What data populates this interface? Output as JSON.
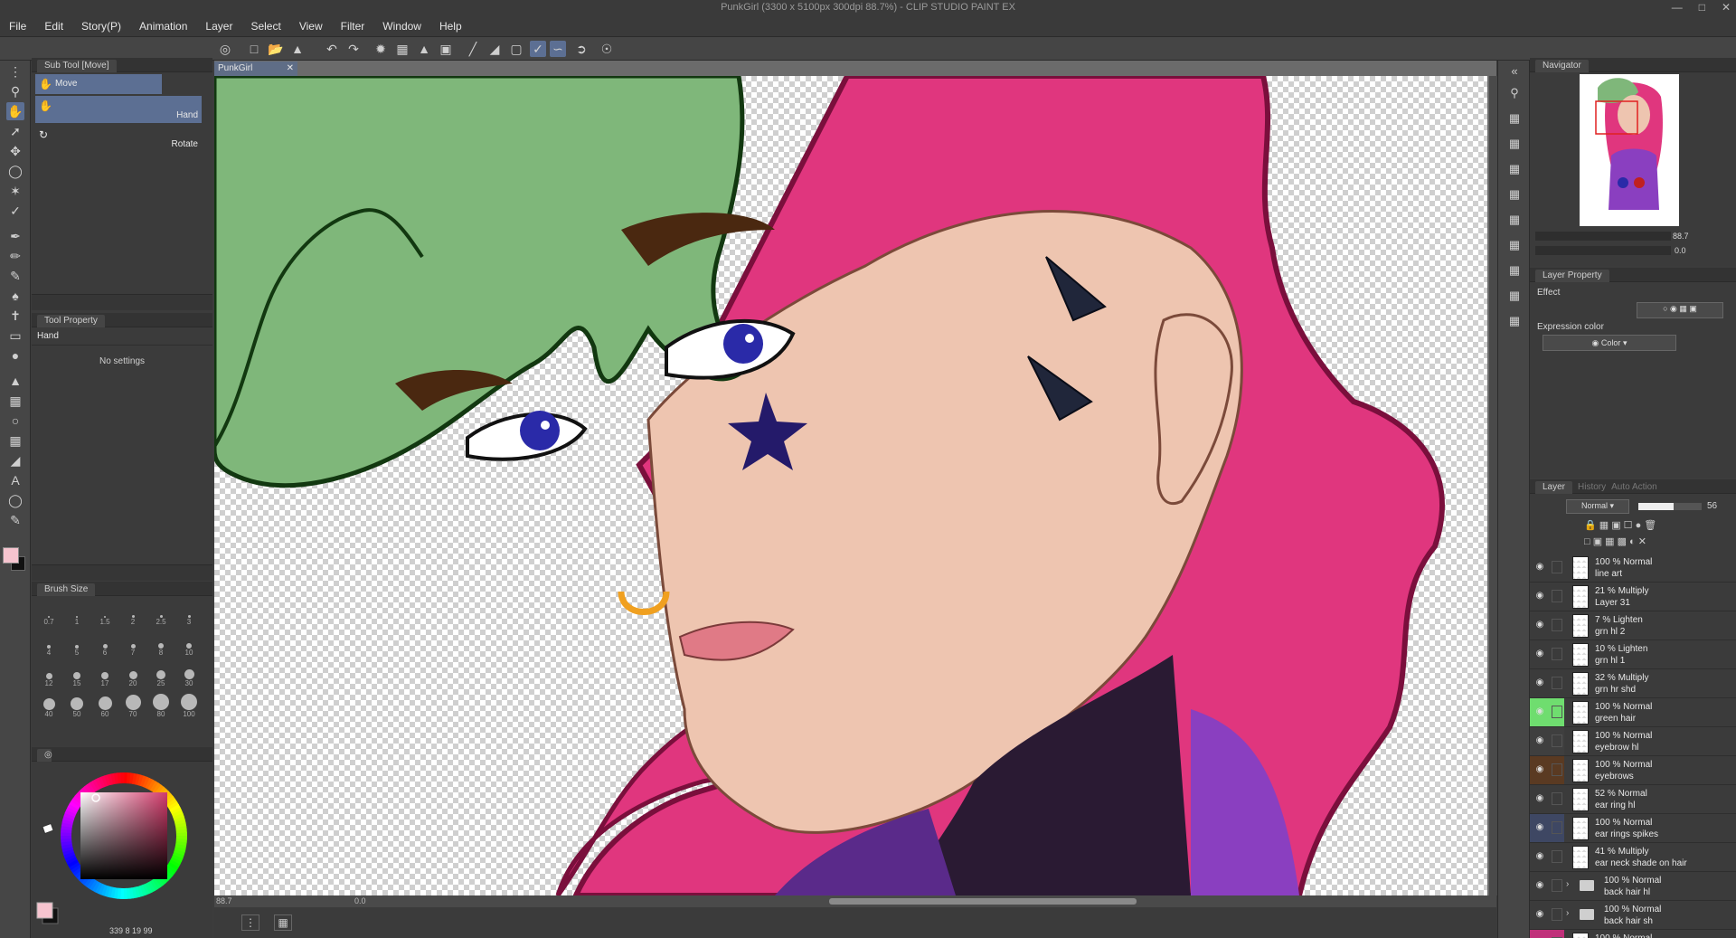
{
  "window": {
    "title": "PunkGirl (3300 x 5100px 300dpi 88.7%)  - CLIP STUDIO PAINT EX"
  },
  "menu": [
    "File",
    "Edit",
    "Story(P)",
    "Animation",
    "Layer",
    "Select",
    "View",
    "Filter",
    "Window",
    "Help"
  ],
  "subtool": {
    "header": "Sub Tool [Move]",
    "group": "Move",
    "items": [
      {
        "label": "Hand"
      },
      {
        "label": "Rotate"
      }
    ]
  },
  "tool_property": {
    "header": "Tool Property",
    "tool_name": "Hand",
    "message": "No settings"
  },
  "brush_size": {
    "header": "Brush Size",
    "sizes": [
      "0.7",
      "1",
      "1.5",
      "2",
      "2.5",
      "3",
      "4",
      "5",
      "6",
      "7",
      "8",
      "10",
      "12",
      "15",
      "17",
      "20",
      "25",
      "30",
      "40",
      "50",
      "60",
      "70",
      "80",
      "100"
    ]
  },
  "color": {
    "main_color": "#f6c4cf",
    "sub_color": "#111111",
    "picker_hue": "#d23b6b",
    "readout": "339  8  19  99"
  },
  "document": {
    "tab": "PunkGirl",
    "zoom": "88.7",
    "angle": "0.0"
  },
  "navigator": {
    "header": "Navigator",
    "zoom": "88.7",
    "rotation": "0.0"
  },
  "layer_property": {
    "header": "Layer Property",
    "effect_label": "Effect",
    "expression_label": "Expression color",
    "expression_value": "Color"
  },
  "layer_panel": {
    "tabs": [
      "Layer",
      "History",
      "Auto Action"
    ],
    "blend_mode": "Normal",
    "opacity": "56",
    "layers": [
      {
        "opacity_mode": "100 % Normal",
        "name": "line art",
        "color": "",
        "group": false
      },
      {
        "opacity_mode": "21 % Multiply",
        "name": "Layer 31",
        "color": "",
        "group": false
      },
      {
        "opacity_mode": "7 % Lighten",
        "name": "grn hl 2",
        "color": "",
        "group": false
      },
      {
        "opacity_mode": "10 % Lighten",
        "name": "grn hl 1",
        "color": "",
        "group": false
      },
      {
        "opacity_mode": "32 % Multiply",
        "name": "grn hr shd",
        "color": "",
        "group": false
      },
      {
        "opacity_mode": "100 % Normal",
        "name": "green hair",
        "color": "#6fdd6f",
        "group": false
      },
      {
        "opacity_mode": "100 % Normal",
        "name": "eyebrow hl",
        "color": "#3f3f3f",
        "group": false
      },
      {
        "opacity_mode": "100 % Normal",
        "name": "eyebrows",
        "color": "#5a3a22",
        "group": false
      },
      {
        "opacity_mode": "52 % Normal",
        "name": "ear ring hl",
        "color": "",
        "group": false
      },
      {
        "opacity_mode": "100 % Normal",
        "name": "ear rings spikes",
        "color": "#3e4763",
        "group": false
      },
      {
        "opacity_mode": "41 % Multiply",
        "name": "ear neck shade on hair",
        "color": "",
        "group": false
      },
      {
        "opacity_mode": "100 % Normal",
        "name": "back hair hl",
        "color": "",
        "group": true
      },
      {
        "opacity_mode": "100 % Normal",
        "name": "back hair sh",
        "color": "",
        "group": true
      },
      {
        "opacity_mode": "100 % Normal",
        "name": "",
        "color": "#c0307a",
        "group": false
      }
    ]
  }
}
